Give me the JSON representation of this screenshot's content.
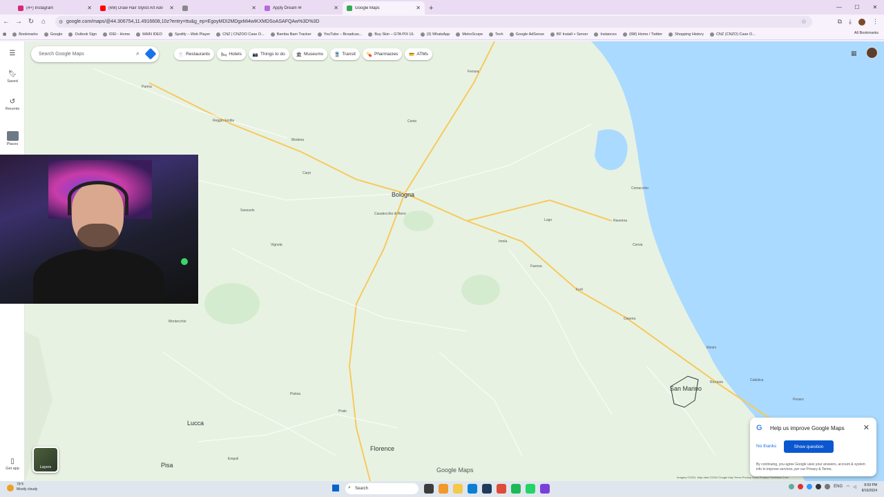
{
  "browser": {
    "tabs": [
      {
        "title": "(4+) Instagram",
        "color": "#d62976"
      },
      {
        "title": "(6M) Draw Hair Stylist Art Adv",
        "color": "#ff0000"
      },
      {
        "title": "",
        "color": "#888888"
      },
      {
        "title": "Apply Dream ✉",
        "color": "#b86bd8"
      },
      {
        "title": "Google Maps",
        "color": "#34a853",
        "active": true
      }
    ],
    "new_tab": "+",
    "url": "google.com/maps/@44.306754,11.4916608,10z?entry=ttu&g_ep=EgoyMDI2MDgxMi4wIKXMDSoASAFQAw%3D%3D",
    "bookmarks": [
      "Bookmarks",
      "Google",
      "Outlook Sign",
      "IDEI - Home",
      "MAIN IDEO",
      "Spotify – Web Player",
      "CNZ | CNZOO Case O...",
      "Bamba Bam Tracker",
      "YouTube – Broadcas...",
      "Buy Skin – GTA PIX UL",
      "(3) WhatsApp",
      "MetroScope",
      "Tech",
      "Google AdSense",
      "BF Install + Server",
      "Instances",
      "(6M) Home / Twitter",
      "Shopping History",
      "CNZ (CNZO) Case O..."
    ],
    "all_bookmarks": "All Bookmarks"
  },
  "maps": {
    "search_placeholder": "Search Google Maps",
    "rail": [
      {
        "label": "Saved",
        "icon": "bookmark-icon"
      },
      {
        "label": "Recents",
        "icon": "history-icon"
      },
      {
        "label": "Places",
        "icon": "place-thumb"
      }
    ],
    "get_app": "Get app",
    "chips": [
      {
        "label": "Restaurants",
        "icon": "🍴"
      },
      {
        "label": "Hotels",
        "icon": "🛏"
      },
      {
        "label": "Things to do",
        "icon": "📷"
      },
      {
        "label": "Museums",
        "icon": "🏛"
      },
      {
        "label": "Transit",
        "icon": "🚆"
      },
      {
        "label": "Pharmacies",
        "icon": "💊"
      },
      {
        "label": "ATMs",
        "icon": "💳"
      }
    ],
    "layers": "Layers",
    "watermark": "Google Maps",
    "attribution": "Imagery ©2024, Map data ©2024 Google   Italy   Terms   Privacy   Send Product Feedback   2 km",
    "improve": {
      "title": "Help us improve Google Maps",
      "no_thanks": "No thanks",
      "show": "Show question",
      "fine_print": "By continuing, you agree Google uses your answers, account & system info to improve services, per our Privacy & Terms."
    },
    "cities": [
      "Parma",
      "Reggio Emilia",
      "Modena",
      "Bologna",
      "Ferrara",
      "Ravenna",
      "Forlì",
      "Cesena",
      "Rimini",
      "San Marino",
      "Lucca",
      "Pisa",
      "Prato",
      "Florence",
      "Pesaro",
      "Imola",
      "Faenza",
      "Lugo",
      "Comacchio",
      "Carpi",
      "Cento",
      "Vignola",
      "Sassuolo",
      "Pistoia",
      "Empoli",
      "Riccione",
      "Cattolica",
      "Cervia",
      "Montecchio",
      "Casalecchio di Reno"
    ]
  },
  "taskbar": {
    "weather_temp": "79°F",
    "weather_desc": "Mostly cloudy",
    "search": "Search",
    "lang": "ENG",
    "time": "8:59 PM",
    "date": "8/16/2024"
  }
}
